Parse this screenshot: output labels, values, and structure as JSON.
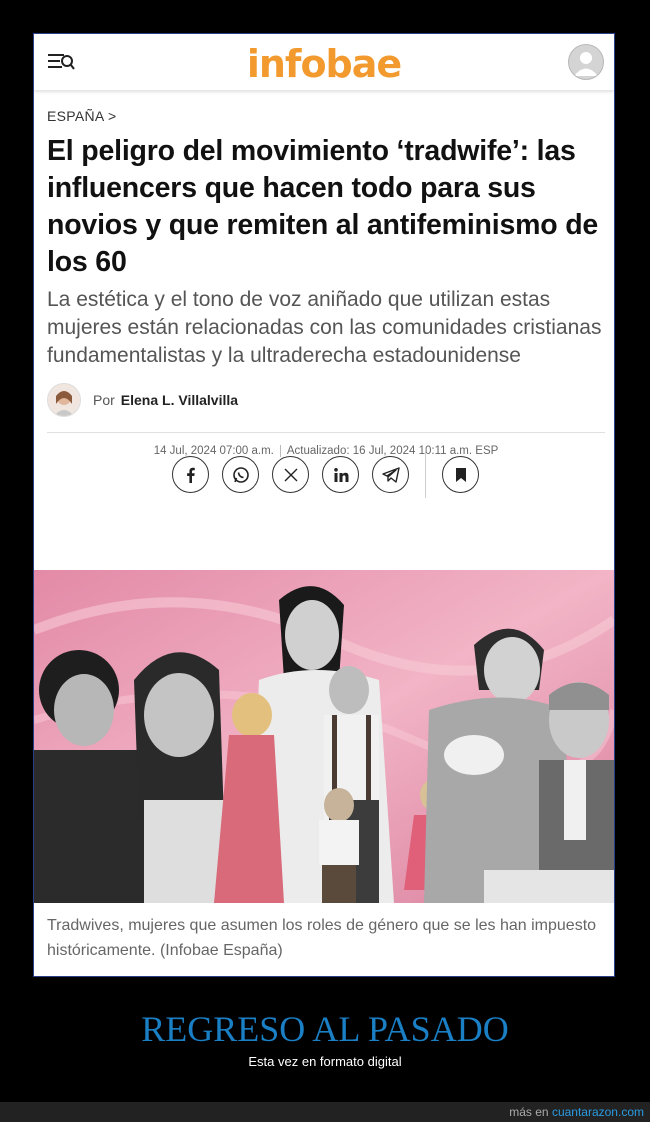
{
  "header": {
    "logo": "infobae"
  },
  "article": {
    "section": "ESPAÑA >",
    "headline": "El peligro del movimiento ‘tradwife’: las influencers que hacen todo para sus novios y que remiten al antifeminismo de los 60",
    "deck": "La estética y el tono de voz aniñado que utilizan estas mujeres están relacionadas con las comunidades cristianas fundamentalistas y la ultraderecha estadounidense",
    "author_prefix": "Por",
    "author_name": "Elena L. Villalvilla",
    "published": "14 Jul, 2024 07:00 a.m.",
    "updated": "Actualizado: 16 Jul, 2024 10:11 a.m. ESP",
    "caption": "Tradwives, mujeres que asumen los roles de género que se les han impuesto históricamente. (Infobae España)"
  },
  "share_icons": [
    "facebook-icon",
    "whatsapp-icon",
    "x-icon",
    "linkedin-icon",
    "telegram-icon",
    "bookmark-icon"
  ],
  "promo": {
    "title": "REGRESO AL PASADO",
    "subtitle": "Esta vez en formato digital"
  },
  "footer": {
    "prefix": "más en",
    "link": "cuantarazon.com"
  },
  "colors": {
    "logo": "#f29a2e",
    "promo_title": "#1a7fc4",
    "link": "#2a9ae0"
  }
}
